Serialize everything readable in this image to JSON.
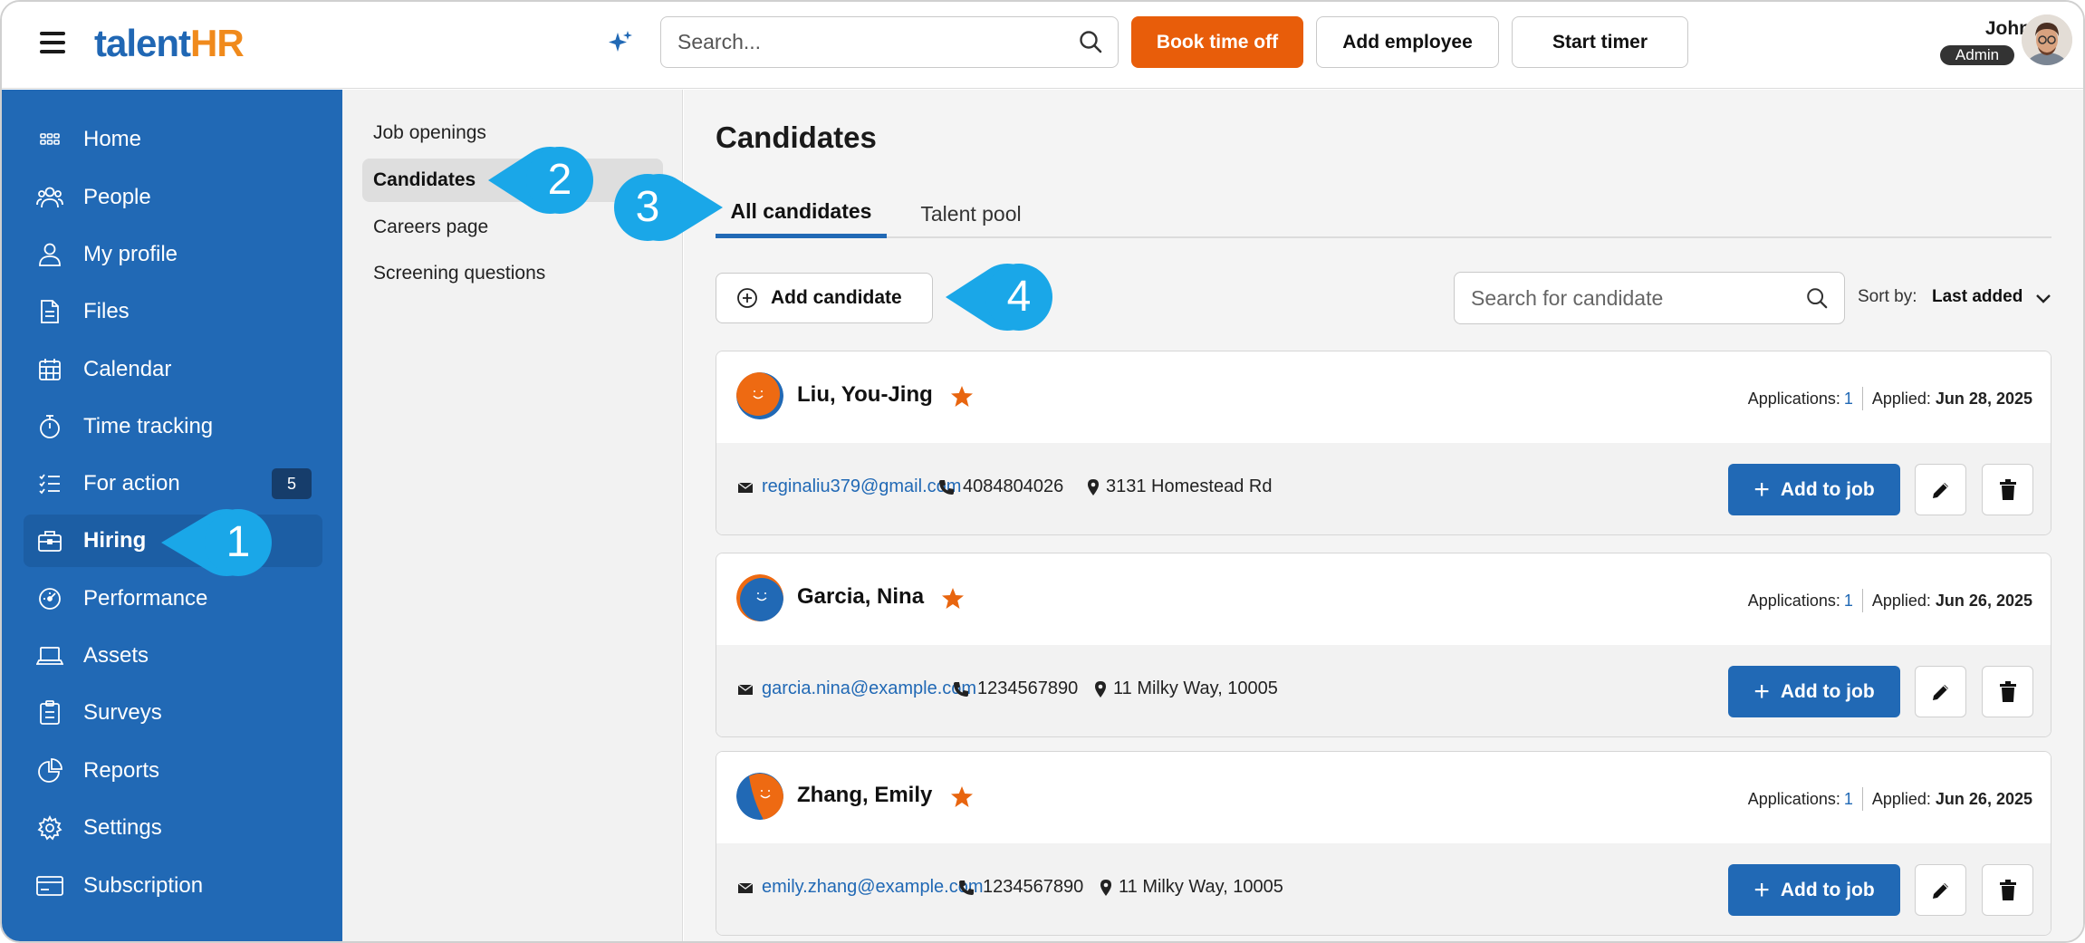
{
  "header": {
    "logo_part1": "talent",
    "logo_part2": "HR",
    "search_placeholder": "Search...",
    "book_time_off": "Book time off",
    "add_employee": "Add employee",
    "start_timer": "Start timer",
    "user_name": "John",
    "user_role": "Admin"
  },
  "sidebar": {
    "items": [
      {
        "label": "Home",
        "icon": "grid-icon"
      },
      {
        "label": "People",
        "icon": "people-icon"
      },
      {
        "label": "My profile",
        "icon": "user-icon"
      },
      {
        "label": "Files",
        "icon": "file-icon"
      },
      {
        "label": "Calendar",
        "icon": "calendar-icon"
      },
      {
        "label": "Time tracking",
        "icon": "stopwatch-icon"
      },
      {
        "label": "For action",
        "icon": "checklist-icon",
        "badge": "5"
      },
      {
        "label": "Hiring",
        "icon": "briefcase-icon",
        "active": true
      },
      {
        "label": "Performance",
        "icon": "gauge-icon"
      },
      {
        "label": "Assets",
        "icon": "laptop-icon"
      },
      {
        "label": "Surveys",
        "icon": "clipboard-icon"
      },
      {
        "label": "Reports",
        "icon": "pie-chart-icon"
      },
      {
        "label": "Settings",
        "icon": "gear-icon"
      },
      {
        "label": "Subscription",
        "icon": "card-icon"
      }
    ]
  },
  "subnav": {
    "items": [
      {
        "label": "Job openings"
      },
      {
        "label": "Candidates",
        "active": true
      },
      {
        "label": "Careers page"
      },
      {
        "label": "Screening questions"
      }
    ]
  },
  "main": {
    "title": "Candidates",
    "tabs": [
      {
        "label": "All candidates",
        "active": true
      },
      {
        "label": "Talent pool"
      }
    ],
    "add_candidate": "Add candidate",
    "search_placeholder": "Search for candidate",
    "sort_label": "Sort by:",
    "sort_value": "Last added"
  },
  "candidates": [
    {
      "name": "Liu, You-Jing",
      "applications_label": "Applications:",
      "applications": "1",
      "applied_label": "Applied:",
      "applied": "Jun 28, 2025",
      "email": "reginaliu379@gmail.com",
      "phone": "4084804026",
      "address": "3131 Homestead Rd"
    },
    {
      "name": "Garcia, Nina",
      "applications_label": "Applications:",
      "applications": "1",
      "applied_label": "Applied:",
      "applied": "Jun 26, 2025",
      "email": "garcia.nina@example.com",
      "phone": "1234567890",
      "address": "11 Milky Way, 10005"
    },
    {
      "name": "Zhang, Emily",
      "applications_label": "Applications:",
      "applications": "1",
      "applied_label": "Applied:",
      "applied": "Jun 26, 2025",
      "email": "emily.zhang@example.com",
      "phone": "1234567890",
      "address": "11 Milky Way, 10005"
    }
  ],
  "add_to_job": "Add to job",
  "callouts": [
    "1",
    "2",
    "3",
    "4"
  ],
  "colors": {
    "brand_blue": "#2169b5",
    "brand_orange": "#e85d0a",
    "callout": "#1aa7e8",
    "star": "#e8650f"
  }
}
